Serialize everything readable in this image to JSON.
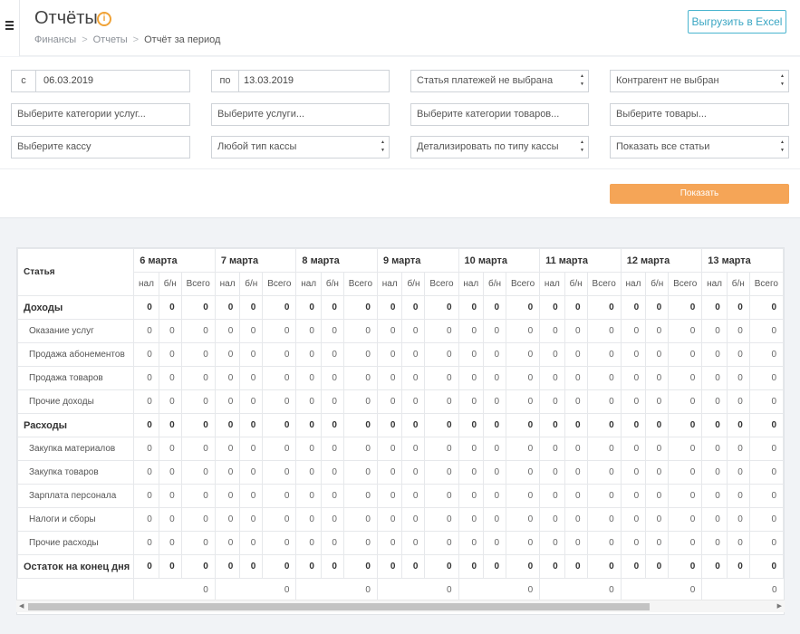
{
  "header": {
    "title": "Отчёты",
    "info_icon_glyph": "i",
    "breadcrumb": [
      "Финансы",
      "Отчеты",
      "Отчёт за период"
    ],
    "export_label": "Выгрузить в Excel",
    "accent_color": "#3aa6c3"
  },
  "filters": {
    "date_from_prefix": "с",
    "date_from": "06.03.2019",
    "date_to_prefix": "по",
    "date_to": "13.03.2019",
    "payment_item": "Статья платежей не выбрана",
    "counterparty": "Контрагент не выбран",
    "service_categories": "Выберите категории услуг...",
    "services": "Выберите услуги...",
    "product_categories": "Выберите категории товаров...",
    "products": "Выберите товары...",
    "cashbox": "Выберите кассу",
    "cashbox_type": "Любой тип кассы",
    "detail_by_cashbox_type": "Детализировать по типу кассы",
    "show_items": "Показать все статьи",
    "show_button": "Показать",
    "show_button_color": "#f5a557"
  },
  "report": {
    "stat_column": "Статья",
    "days": [
      "6 марта",
      "7 марта",
      "8 марта",
      "9 марта",
      "10 марта",
      "11 марта",
      "12 марта",
      "13 марта"
    ],
    "subcolumns": [
      "нал",
      "б/н",
      "Всего"
    ],
    "rows": [
      {
        "label": "Доходы",
        "group": true,
        "value": "0"
      },
      {
        "label": "Оказание услуг",
        "group": false,
        "value": "0"
      },
      {
        "label": "Продажа абонементов",
        "group": false,
        "value": "0"
      },
      {
        "label": "Продажа товаров",
        "group": false,
        "value": "0"
      },
      {
        "label": "Прочие доходы",
        "group": false,
        "value": "0"
      },
      {
        "label": "Расходы",
        "group": true,
        "value": "0"
      },
      {
        "label": "Закупка материалов",
        "group": false,
        "value": "0"
      },
      {
        "label": "Закупка товаров",
        "group": false,
        "value": "0"
      },
      {
        "label": "Зарплата персонала",
        "group": false,
        "value": "0"
      },
      {
        "label": "Налоги и сборы",
        "group": false,
        "value": "0"
      },
      {
        "label": "Прочие расходы",
        "group": false,
        "value": "0"
      },
      {
        "label": "Остаток на конец дня",
        "group": true,
        "value": "0"
      }
    ],
    "day_totals": [
      "0",
      "0",
      "0",
      "0",
      "0",
      "0",
      "0",
      "0"
    ]
  },
  "scrollbar": {
    "left_arrow_glyph": "◀",
    "right_arrow_glyph": "▶"
  }
}
